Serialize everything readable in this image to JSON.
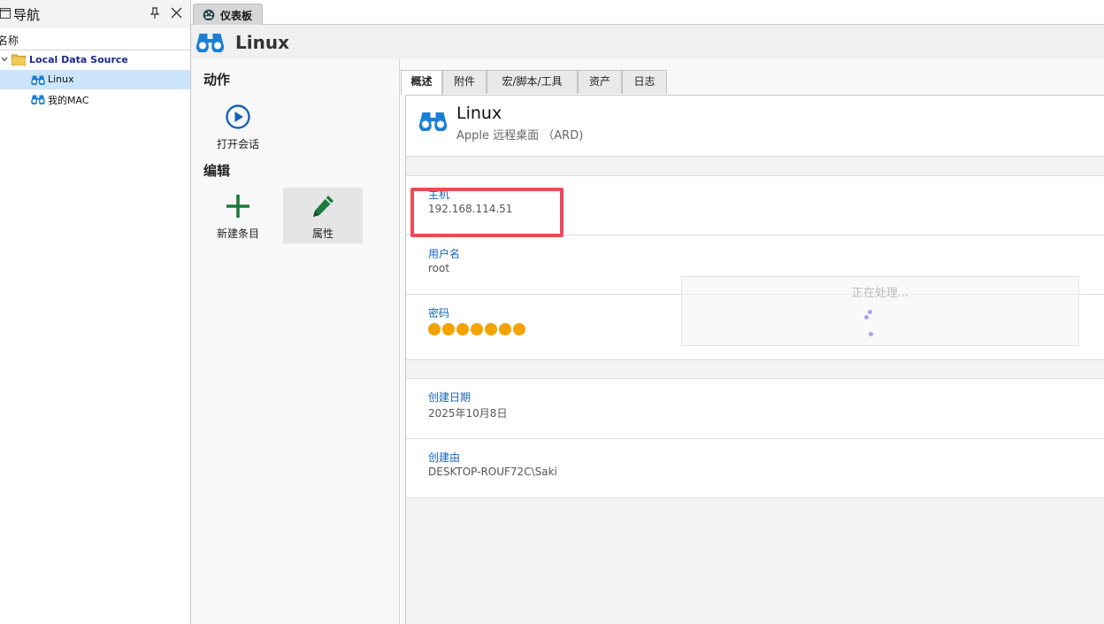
{
  "navigation": {
    "title": "导航",
    "column_header": "名称",
    "tree": {
      "root_label": "Local Data Source",
      "items": [
        {
          "label": "Linux",
          "selected": true
        },
        {
          "label": "我的MAC",
          "selected": false
        }
      ]
    }
  },
  "document_tab": {
    "label": "仪表板"
  },
  "header": {
    "title": "Linux"
  },
  "actions": {
    "section_actions": "动作",
    "open_session": "打开会话",
    "section_edit": "编辑",
    "new_entry": "新建条目",
    "properties": "属性"
  },
  "content_tabs": [
    {
      "label": "概述",
      "active": true
    },
    {
      "label": "附件",
      "active": false
    },
    {
      "label": "宏/脚本/工具",
      "active": false
    },
    {
      "label": "资产",
      "active": false
    },
    {
      "label": "日志",
      "active": false
    }
  ],
  "entry": {
    "name": "Linux",
    "subtitle": "Apple 远程桌面 （ARD)"
  },
  "fields": {
    "host": {
      "label": "主机",
      "value": "192.168.114.51"
    },
    "username": {
      "label": "用户名",
      "value": "root"
    },
    "password": {
      "label": "密码",
      "masked_dot_count": 7
    },
    "created_date": {
      "label": "创建日期",
      "value": "2025年10月8日"
    },
    "created_by": {
      "label": "创建由",
      "value": "DESKTOP-ROUF72C\\Saki"
    }
  },
  "overlay": {
    "processing_text": "正在处理..."
  },
  "colors": {
    "accent_blue": "#1663b7",
    "binocular_blue": "#1a7fd6",
    "add_green": "#1d7a3c",
    "password_dot": "#f5a300",
    "highlight_red": "#ec4a58",
    "selected_row": "#cce5fb"
  },
  "icons": {
    "entry": "binoculars-icon",
    "open_session": "play-circle-icon",
    "new_entry": "plus-icon",
    "properties": "pencil-icon",
    "folder": "folder-icon",
    "dashboard": "dashboard-icon"
  }
}
